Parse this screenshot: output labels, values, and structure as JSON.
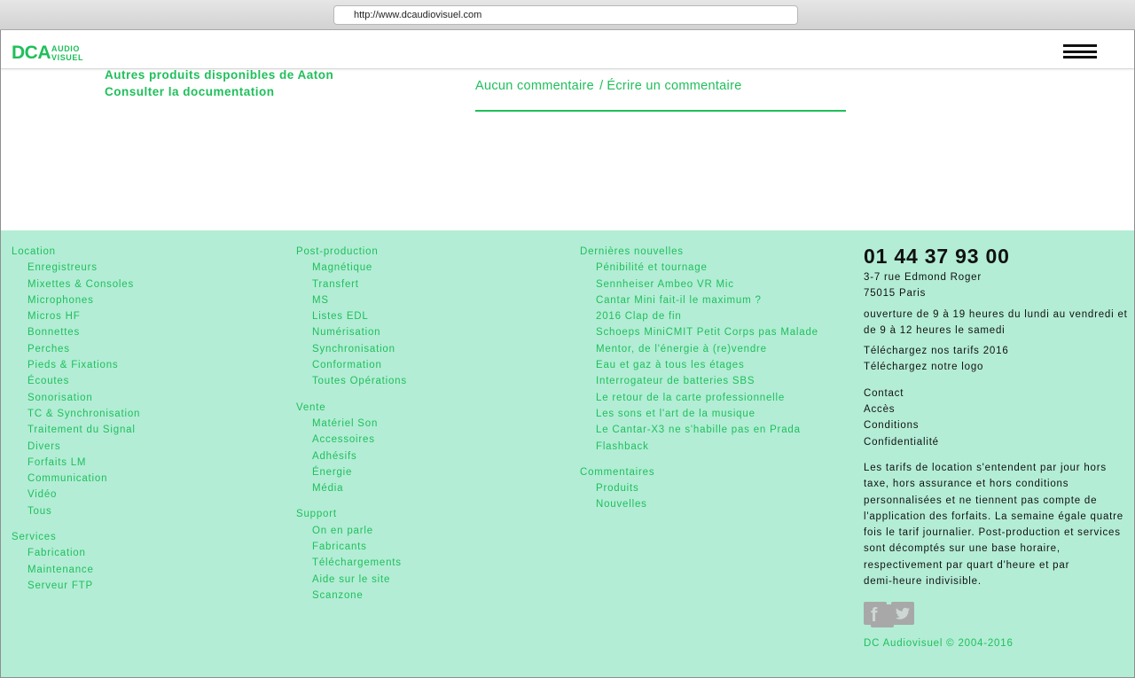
{
  "browser": {
    "url": "http://www.dcaudiovisuel.com"
  },
  "header": {
    "logo_main": "DCA",
    "logo_sub_top": "AUDIO",
    "logo_sub_bottom": "VISUEL"
  },
  "main": {
    "links": [
      "Autres produits disponibles de Aaton",
      "Consulter la documentation"
    ],
    "comments_none": "Aucun commentaire",
    "comments_separator": "/",
    "comments_write": "Écrire un commentaire"
  },
  "footer": {
    "col1": {
      "location_title": "Location",
      "location_items": [
        "Enregistreurs",
        "Mixettes & Consoles",
        "Microphones",
        "Micros HF",
        "Bonnettes",
        "Perches",
        "Pieds & Fixations",
        "Écoutes",
        "Sonorisation",
        "TC & Synchronisation",
        "Traitement du Signal",
        "Divers",
        "Forfaits LM",
        "Communication",
        "Vidéo",
        "Tous"
      ],
      "services_title": "Services",
      "services_items": [
        "Fabrication",
        "Maintenance",
        "Serveur FTP"
      ]
    },
    "col2": {
      "post_title": "Post-production",
      "post_items": [
        "Magnétique",
        "Transfert",
        "MS",
        "Listes EDL",
        "Numérisation",
        "Synchronisation",
        "Conformation",
        "Toutes Opérations"
      ],
      "vente_title": "Vente",
      "vente_items": [
        "Matériel Son",
        "Accessoires",
        "Adhésifs",
        "Énergie",
        "Média"
      ],
      "support_title": "Support",
      "support_items": [
        "On en parle",
        "Fabricants",
        "Téléchargements",
        "Aide sur le site",
        "Scanzone"
      ]
    },
    "col3": {
      "news_title": "Dernières nouvelles",
      "news_items": [
        "Pénibilité et tournage",
        "Sennheiser Ambeo VR Mic",
        "Cantar Mini fait-il le maximum ?",
        "2016 Clap de fin",
        "Schoeps MiniCMIT Petit Corps pas Malade",
        "Mentor, de l'énergie à (re)vendre",
        "Eau et gaz à tous les étages",
        "Interrogateur de batteries SBS",
        "Le retour de la carte professionnelle",
        "Les sons et l'art de la musique",
        "Le Cantar-X3 ne s'habille pas en Prada",
        "Flashback"
      ],
      "comments_title": "Commentaires",
      "comments_items": [
        "Produits",
        "Nouvelles"
      ]
    },
    "info": {
      "phone": "01 44 37 93 00",
      "address_1": "3-7 rue Edmond Roger",
      "address_2": "75015 Paris",
      "hours_1": "ouverture de 9 à 19 heures du lundi au vendredi et",
      "hours_2": "de 9 à 12 heures le samedi",
      "download_tarifs": "Téléchargez nos tarifs 2016",
      "download_logo": "Téléchargez notre logo",
      "links": [
        "Contact",
        "Accès",
        "Conditions",
        "Confidentialité"
      ],
      "notice_lines": [
        "Les tarifs de location s'entendent par jour hors",
        "taxe, hors assurance et hors conditions",
        "personnalisées et ne tiennent pas compte de",
        "l'application des forfaits. La semaine égale quatre",
        "fois le tarif journalier. Post-production et services",
        "sont décomptés sur une base horaire,",
        "respectivement par quart d'heure et par",
        "demi-heure indivisible."
      ],
      "facebook_glyph": "f",
      "copyright": "DC Audiovisuel © 2004-2016"
    }
  },
  "colors": {
    "accent": "#1fbf5a",
    "footer_bg": "#b3edd6",
    "icon_gray": "#a8a8a8"
  }
}
